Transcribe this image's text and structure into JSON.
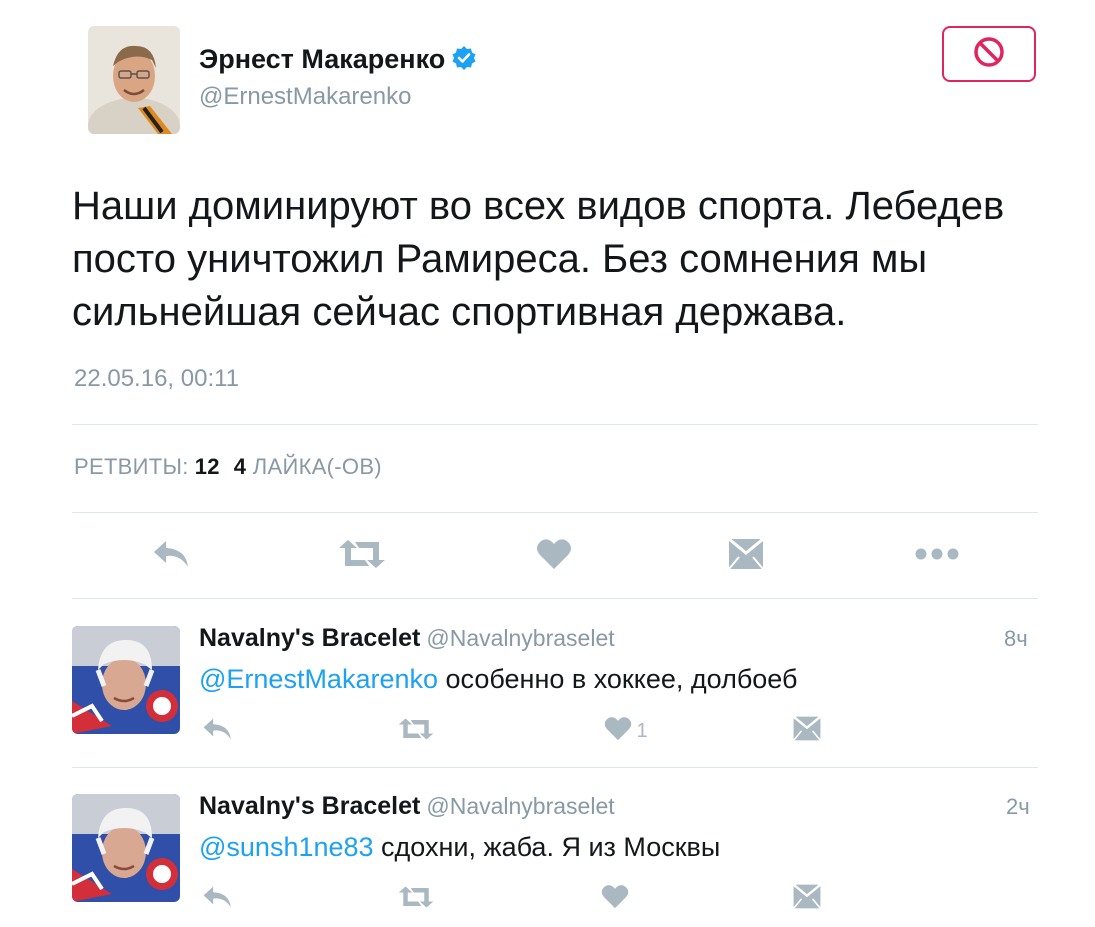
{
  "tweet": {
    "author_name": "Эрнест Макаренко",
    "author_handle": "@ErnestMakarenko",
    "text": "Наши доминируют во всех видов спорта. Лебедев посто уничтожил Рамиреса. Без сомнения мы сильнейшая сейчас спортивная держава.",
    "timestamp": "22.05.16, 00:11",
    "retweets_label": "РЕТВИТЫ:",
    "retweets_count": "12",
    "likes_count": "4",
    "likes_label": "ЛАЙКА(-ОВ)"
  },
  "actions": {
    "icons": [
      "reply-icon",
      "retweet-icon",
      "like-icon",
      "direct-message-icon",
      "more-icon"
    ]
  },
  "replies": [
    {
      "name": "Navalny's Bracelet",
      "handle": "@Navalnybraselet",
      "time": "8ч",
      "mention": "@ErnestMakarenko",
      "text": " особенно в хоккее, долбоеб",
      "like_count": "1"
    },
    {
      "name": "Navalny's Bracelet",
      "handle": "@Navalnybraselet",
      "time": "2ч",
      "mention": "@sunsh1ne83",
      "text": " сдохни, жаба. Я из Москвы",
      "like_count": ""
    }
  ],
  "colors": {
    "accent": "#1da1f2",
    "block": "#e0245e",
    "muted": "#8899a6",
    "icon": "#aab8c2"
  }
}
